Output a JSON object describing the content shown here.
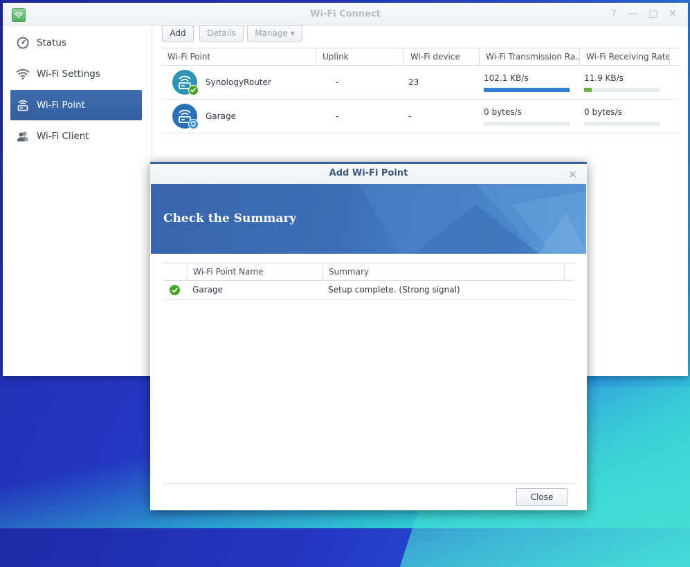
{
  "window": {
    "title": "Wi-Fi Connect",
    "controls": {
      "help": "?",
      "minimize": "—",
      "maximize": "□",
      "close": "✕"
    }
  },
  "sidebar": {
    "items": [
      {
        "label": "Status",
        "icon": "gauge-icon",
        "active": false
      },
      {
        "label": "Wi-Fi Settings",
        "icon": "wifi-icon",
        "active": false
      },
      {
        "label": "Wi-Fi Point",
        "icon": "router-wifi-icon",
        "active": true
      },
      {
        "label": "Wi-Fi Client",
        "icon": "users-icon",
        "active": false
      }
    ]
  },
  "toolbar": {
    "add_label": "Add",
    "details_label": "Details",
    "manage_label": "Manage ▾"
  },
  "table": {
    "columns": [
      "Wi-Fi Point",
      "Uplink",
      "Wi-Fi device",
      "Wi-Fi Transmission Ra...",
      "Wi-Fi Receiving Rate"
    ],
    "rows": [
      {
        "name": "SynologyRouter",
        "uplink": "-",
        "devices": "23",
        "tx": "102.1 KB/s",
        "tx_level": 1.0,
        "rx": "11.9 KB/s",
        "rx_level": 0.1,
        "status": "connected"
      },
      {
        "name": "Garage",
        "uplink": "-",
        "devices": "-",
        "tx": "0 bytes/s",
        "tx_level": 0,
        "rx": "0 bytes/s",
        "rx_level": 0,
        "status": "syncing"
      }
    ]
  },
  "dialog": {
    "title": "Add Wi-Fi Point",
    "banner_title": "Check the Summary",
    "columns": [
      "Wi-Fi Point Name",
      "Summary"
    ],
    "rows": [
      {
        "name": "Garage",
        "summary": "Setup complete. (Strong signal)",
        "status": "success"
      }
    ],
    "close_label": "Close",
    "close_icon": "×"
  },
  "colors": {
    "accent": "#3a61a3",
    "tx_bar": "#2f7fd6",
    "rx_bar": "#6db33f",
    "success": "#46a31f"
  }
}
